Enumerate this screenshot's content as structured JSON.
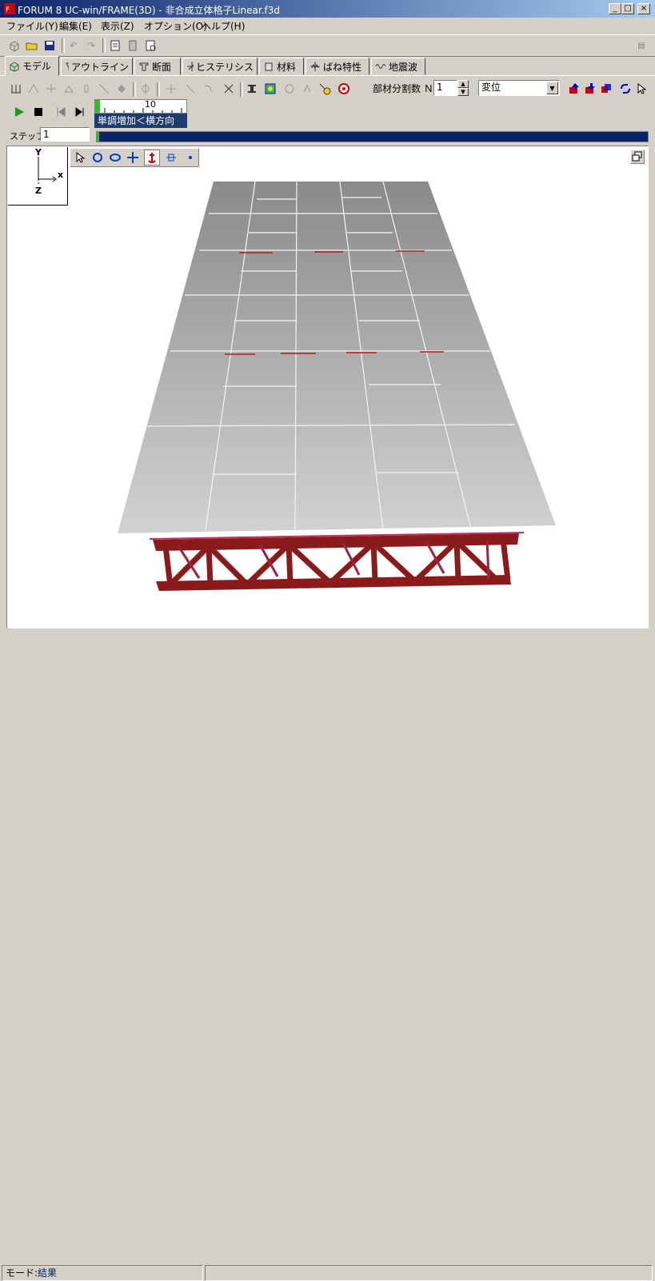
{
  "window": {
    "title": "FORUM 8  UC-win/FRAME(3D) - 非合成立体格子Linear.f3d",
    "minimize": "_",
    "maximize": "□",
    "close": "×"
  },
  "menu": [
    "ファイル(Y)",
    "編集(E)",
    "表示(Z)",
    "オプション(O)",
    "ヘルプ(H)"
  ],
  "tabs": [
    {
      "label": "モデル",
      "icon": "model-cube-icon",
      "active": true
    },
    {
      "label": "アウトライン",
      "icon": "outline-icon"
    },
    {
      "label": "断面",
      "icon": "section-icon"
    },
    {
      "label": "ヒステリシス",
      "icon": "hysteresis-icon"
    },
    {
      "label": "材料",
      "icon": "material-icon"
    },
    {
      "label": "ばね特性",
      "icon": "spring-icon"
    },
    {
      "label": "地震波",
      "icon": "seismic-wave-icon"
    }
  ],
  "toolbar2": {
    "divisions_label": "部材分割数 Ｎ",
    "divisions_value": "1",
    "result_select": "変位"
  },
  "animation": {
    "tick_label": "10",
    "loadcase": "単調増加＜横方向",
    "step_label": "ステップ",
    "step_value": "1",
    "progress": 0.005
  },
  "axes": {
    "y": "Y",
    "x": "x",
    "z": "Z"
  },
  "status": {
    "mode_label": "モード:",
    "mode_value": "結果"
  },
  "colors": {
    "accent": "#0a246a",
    "truss": "#8b1a1a",
    "deck": "#a8a8a8",
    "progress": "#0a246a",
    "play": "#1a9a1a"
  }
}
